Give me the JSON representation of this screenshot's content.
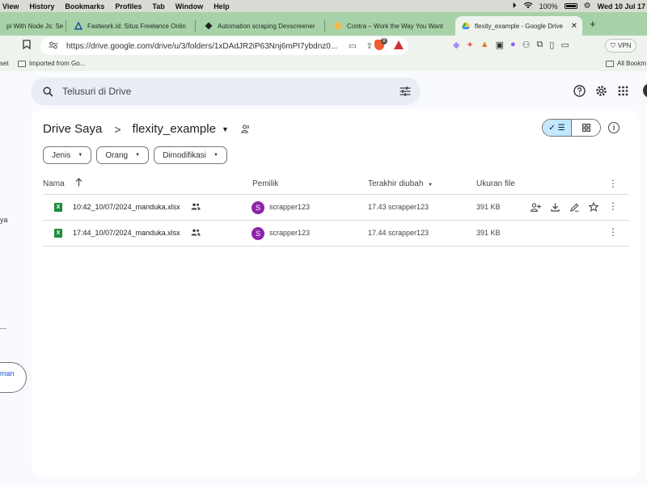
{
  "os_menubar": {
    "items": [
      "View",
      "History",
      "Bookmarks",
      "Profiles",
      "Tab",
      "Window",
      "Help"
    ],
    "battery": "100%",
    "clock": "Wed 10 Jul  17"
  },
  "browser": {
    "tabs": [
      {
        "title": "pi With Node Js: Se",
        "active": false
      },
      {
        "title": "Fastwork.id: Situs Freelance Onlin",
        "active": false
      },
      {
        "title": "Automation scraping Dexscreener",
        "active": false
      },
      {
        "title": "Contra – Work the Way You Want",
        "active": false
      },
      {
        "title": "flexity_example - Google Drive",
        "active": true
      }
    ],
    "new_tab": "+",
    "url": "https://drive.google.com/drive/u/3/folders/1xDAdJR2iP63Nnj6mPI7ybdnz0...",
    "brave_badge": "8",
    "vpn_label": "VPN",
    "bookmarks": [
      {
        "label": "set"
      },
      {
        "label": "Imported from Go..."
      },
      {
        "label": "All Bookm"
      }
    ]
  },
  "drive": {
    "search_placeholder": "Telusuri di Drive",
    "left_rail": {
      "partial_label_1": "ya",
      "partial_label_2": "man"
    },
    "breadcrumb": {
      "root": "Drive Saya",
      "separator": ">",
      "current": "flexity_example"
    },
    "filters": [
      "Jenis",
      "Orang",
      "Dimodifikasi"
    ],
    "columns": {
      "name": "Nama",
      "owner": "Pemilik",
      "modified": "Terakhir diubah",
      "size": "Ukuran file"
    },
    "files": [
      {
        "name": "10:42_10/07/2024_manduka.xlsx",
        "owner_initial": "S",
        "owner": "scrapper123",
        "modified": "17.43 scrapper123",
        "size": "391 KB"
      },
      {
        "name": "17:44_10/07/2024_manduka.xlsx",
        "owner_initial": "S",
        "owner": "scrapper123",
        "modified": "17.44 scrapper123",
        "size": "391 KB"
      }
    ],
    "colors": {
      "accent": "#c2e7ff",
      "avatar": "#8e24aa",
      "sheet_icon": "#1e8e3e",
      "tab_strip": "#a7d2a8"
    }
  }
}
